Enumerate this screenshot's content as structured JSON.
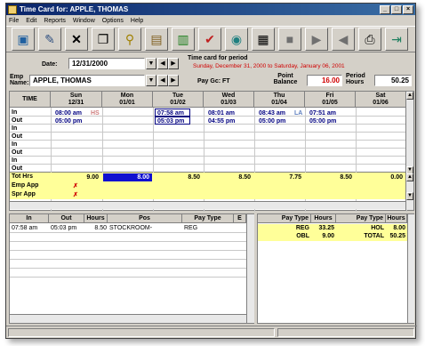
{
  "window": {
    "title": "Time Card for: APPLE, THOMAS",
    "minimize": "_",
    "maximize": "□",
    "close": "×"
  },
  "menu": [
    "File",
    "Edit",
    "Reports",
    "Window",
    "Options",
    "Help"
  ],
  "toolbar_icons": [
    "save-icon",
    "edit-icon",
    "delete-icon",
    "copy-icon",
    "search-icon",
    "folder-icon",
    "chart-icon",
    "check-icon",
    "lookup-icon",
    "calculator-icon",
    "stop-icon",
    "next-icon",
    "previous-icon",
    "print-icon",
    "exit-icon"
  ],
  "header": {
    "date_label": "Date:",
    "date_value": "12/31/2000",
    "emp_label": "Emp Name:",
    "emp_value": "APPLE, THOMAS",
    "period_title": "Time card for period",
    "period_range": "Sunday, December 31, 2000 to Saturday, January 06, 2001",
    "pay_gc": "Pay Gc: FT",
    "point_balance_label": "Point Balance",
    "point_balance_value": "16.00",
    "period_hours_label": "Period Hours",
    "period_hours_value": "50.25"
  },
  "grid": {
    "time_header": "TIME",
    "days": [
      {
        "name": "Sun",
        "date": "12/31"
      },
      {
        "name": "Mon",
        "date": "01/01"
      },
      {
        "name": "Tue",
        "date": "01/02"
      },
      {
        "name": "Wed",
        "date": "01/03"
      },
      {
        "name": "Thu",
        "date": "01/04"
      },
      {
        "name": "Fri",
        "date": "01/05"
      },
      {
        "name": "Sat",
        "date": "01/06"
      }
    ],
    "row_labels": [
      "In",
      "Out",
      "In",
      "Out",
      "In",
      "Out",
      "In",
      "Out"
    ],
    "punches": {
      "sun_in": "08:00 am",
      "sun_out": "05:00 pm",
      "sun_flag": "HS",
      "tue_in": "07:58 am",
      "tue_out": "05:03 pm",
      "wed_in": "08:01 am",
      "wed_out": "04:55 pm",
      "thu_in": "08:43 am",
      "thu_out": "05:00 pm",
      "thu_flag": "LA",
      "fri_in": "07:51 am",
      "fri_out": "05:00 pm"
    },
    "tot_label": "Tot Hrs",
    "totals": [
      "9.00",
      "8.00",
      "8.50",
      "8.50",
      "7.75",
      "8.50",
      "0.00"
    ],
    "emp_app_label": "Emp App",
    "spr_app_label": "Spr App",
    "approval_mark": "✗"
  },
  "detail": {
    "headers": [
      "In",
      "Out",
      "Hours",
      "Pos",
      "Pay Type",
      "E"
    ],
    "row": {
      "in": "07:58 am",
      "out": "05:03 pm",
      "hours": "8.50",
      "pos": "STOCKROOM-",
      "pay_type": "REG"
    }
  },
  "summary": {
    "headers": [
      "Pay Type",
      "Hours",
      "Pay Type",
      "Hours"
    ],
    "rows": [
      [
        "REG",
        "33.25",
        "HOL",
        "8.00"
      ],
      [
        "OBL",
        "9.00",
        "TOTAL",
        "50.25"
      ]
    ]
  }
}
